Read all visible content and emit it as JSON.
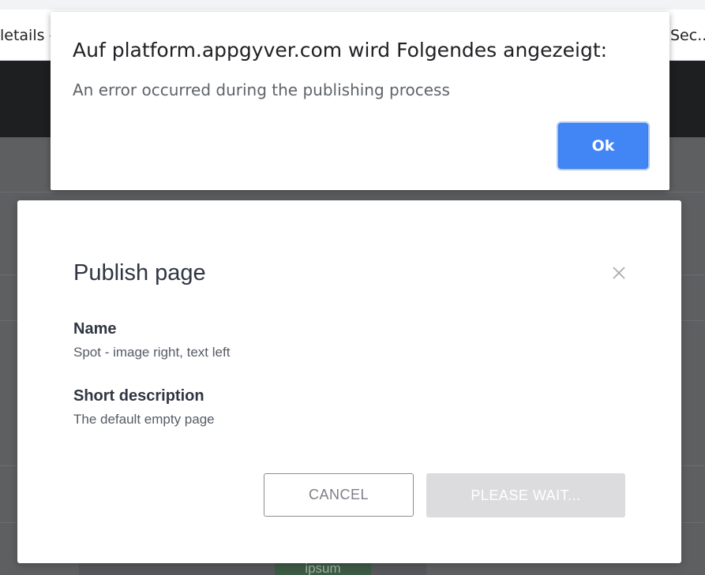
{
  "browser": {
    "bookmark_left": "letails -",
    "bookmark_right": "Sec..."
  },
  "background_app": {
    "chip_text": "ipsum"
  },
  "alert": {
    "title": "Auf platform.appgyver.com wird Folgendes angezeigt:",
    "message": "An error occurred during the publishing process",
    "ok_label": "Ok",
    "ok_color": "#4285f4"
  },
  "publish_modal": {
    "title": "Publish page",
    "close_icon": "close-icon",
    "fields": [
      {
        "label": "Name",
        "value": "Spot - image right, text left"
      },
      {
        "label": "Short description",
        "value": "The default empty page"
      }
    ],
    "cancel_label": "CANCEL",
    "wait_label": "PLEASE WAIT...",
    "wait_disabled": true
  }
}
